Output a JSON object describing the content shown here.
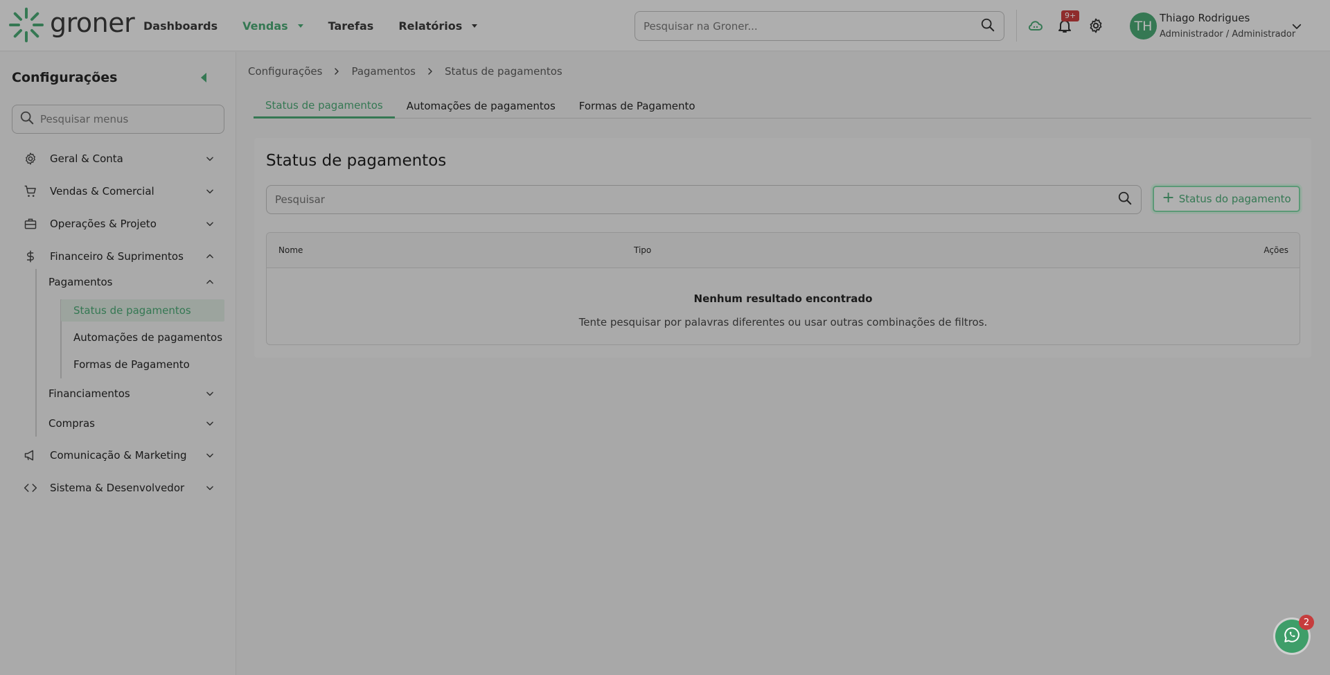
{
  "app": {
    "brand": "groner",
    "accent_color": "#4aa774"
  },
  "header": {
    "nav": [
      {
        "label": "Dashboards",
        "active": false,
        "dropdown": false
      },
      {
        "label": "Vendas",
        "active": true,
        "dropdown": true
      },
      {
        "label": "Tarefas",
        "active": false,
        "dropdown": false
      },
      {
        "label": "Relatórios",
        "active": false,
        "dropdown": true
      }
    ],
    "search": {
      "placeholder": "Pesquisar na Groner...",
      "icon": "search-icon"
    },
    "notifications_badge": "9+",
    "user": {
      "initials": "TH",
      "name": "Thiago Rodrigues",
      "role": "Administrador / Administrador"
    }
  },
  "sidebar": {
    "title": "Configurações",
    "search_placeholder": "Pesquisar menus",
    "sections": [
      {
        "label": "Geral & Conta",
        "icon": "gear-icon",
        "expanded": false
      },
      {
        "label": "Vendas & Comercial",
        "icon": "cart-icon",
        "expanded": false
      },
      {
        "label": "Operações & Projeto",
        "icon": "briefcase-icon",
        "expanded": false
      },
      {
        "label": "Financeiro & Suprimentos",
        "icon": "dollar-icon",
        "expanded": true
      },
      {
        "label": "Comunicação & Marketing",
        "icon": "megaphone-icon",
        "expanded": false
      },
      {
        "label": "Sistema & Desenvolvedor",
        "icon": "code-icon",
        "expanded": false
      }
    ],
    "subsections": [
      {
        "label": "Pagamentos",
        "expanded": true
      },
      {
        "label": "Financiamentos",
        "expanded": false
      },
      {
        "label": "Compras",
        "expanded": false
      }
    ],
    "leaves": [
      {
        "label": "Status de pagamentos",
        "active": true
      },
      {
        "label": "Automações de pagamentos",
        "active": false
      },
      {
        "label": "Formas de Pagamento",
        "active": false
      }
    ]
  },
  "breadcrumb": [
    "Configurações",
    "Pagamentos",
    "Status de pagamentos"
  ],
  "tabs": [
    {
      "label": "Status de pagamentos",
      "active": true
    },
    {
      "label": "Automações de pagamentos",
      "active": false
    },
    {
      "label": "Formas de Pagamento",
      "active": false
    }
  ],
  "main": {
    "title": "Status de pagamentos",
    "search_placeholder": "Pesquisar",
    "add_button": "Status do pagamento",
    "table": {
      "columns": [
        "Nome",
        "Tipo",
        "Ações"
      ],
      "rows": [],
      "empty_title": "Nenhum resultado encontrado",
      "empty_subtitle": "Tente pesquisar por palavras diferentes ou usar outras combinações de filtros."
    }
  },
  "chat": {
    "badge": "2",
    "icon": "whatsapp-icon"
  }
}
